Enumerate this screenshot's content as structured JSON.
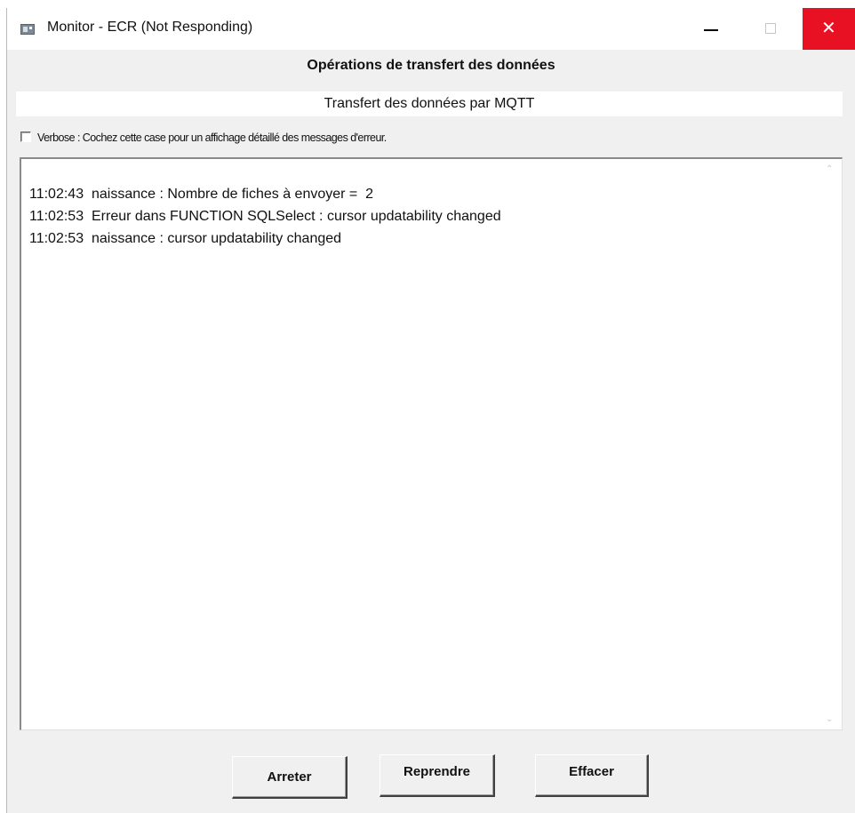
{
  "window": {
    "title": "Monitor - ECR (Not Responding)",
    "close_glyph": "✕"
  },
  "header": {
    "title": "Opérations de transfert des données",
    "subtitle": "Transfert des données par MQTT"
  },
  "verbose": {
    "checked": false,
    "label": "Verbose : Cochez cette case pour un affichage détaillé des messages d'erreur."
  },
  "log": {
    "lines": [
      "11:02:43  naissance : Nombre de fiches à envoyer =  2",
      "11:02:53  Erreur dans FUNCTION SQLSelect : cursor updatability changed",
      "11:02:53  naissance : cursor updatability changed"
    ]
  },
  "buttons": {
    "stop_label": "Arreter",
    "resume_label": "Reprendre",
    "clear_label": "Effacer"
  },
  "colors": {
    "close_button": "#e81123",
    "window_background": "#f0f0f0"
  }
}
